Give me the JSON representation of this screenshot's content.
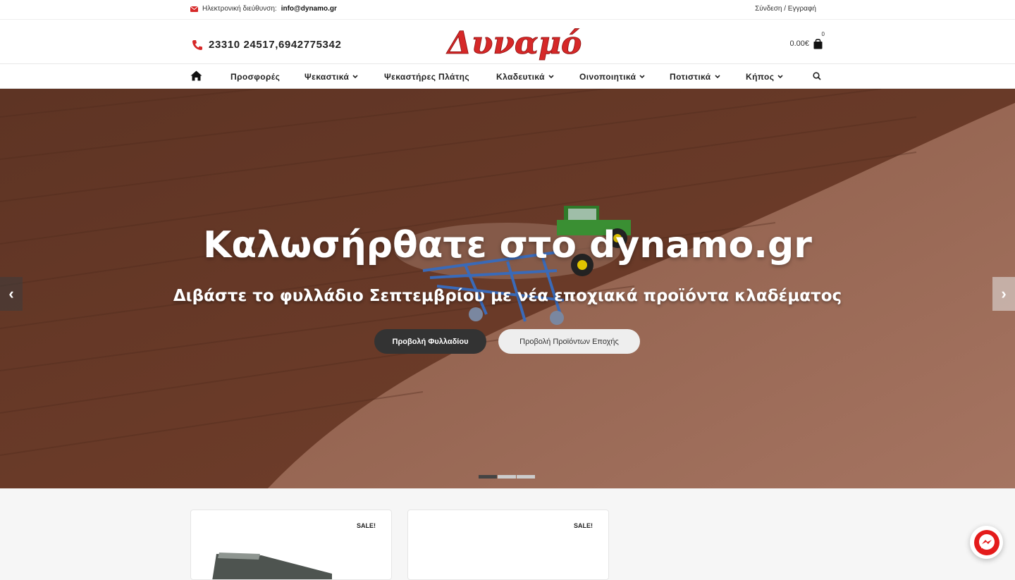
{
  "topbar": {
    "email_label": "Ηλεκτρονική διεύθυνση:",
    "email_value": "info@dynamo.gr",
    "login_label": "Σύνδεση / Εγγραφή"
  },
  "header": {
    "phone": "23310 24517,6942775342",
    "logo_text": "Δυναμό",
    "cart_total": "0.00€",
    "cart_count": "0"
  },
  "nav": {
    "items": [
      {
        "label": "Προσφορές"
      },
      {
        "label": "Ψεκαστικά"
      },
      {
        "label": "Ψεκαστήρες Πλάτης"
      },
      {
        "label": "Κλαδευτικά"
      },
      {
        "label": "Οινοποιητικά"
      },
      {
        "label": "Ποτιστικά"
      },
      {
        "label": "Κήπος"
      }
    ]
  },
  "hero": {
    "title": "Καλωσήρθατε στο dynamo.gr",
    "subtitle": "Διβάστε το φυλλάδιο Σεπτεμβρίου με νέα εποχιακά προϊόντα κλαδέματος",
    "primary_button": "Προβολή Φυλλαδίου",
    "secondary_button": "Προβολή Προϊόντων Εποχής",
    "prev_arrow": "‹",
    "next_arrow": "›"
  },
  "products": {
    "badges": [
      "SALE!",
      "SALE!"
    ]
  },
  "colors": {
    "brand_red": "#d62828",
    "dark_button": "#333333",
    "soil_dark": "#6a3e2c",
    "soil_light": "#9b6a55"
  }
}
